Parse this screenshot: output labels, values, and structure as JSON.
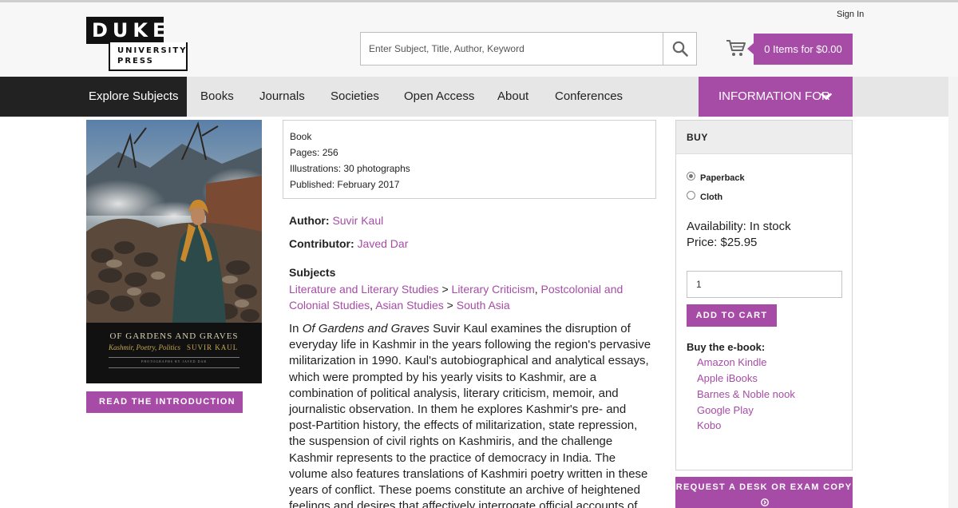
{
  "header": {
    "logo_word": "DUKE",
    "logo_sub_1": "UNIVERSITY",
    "logo_sub_2": "PRESS",
    "sign_in": "Sign In",
    "search_placeholder": "Enter Subject, Title, Author, Keyword",
    "cart_label": "0 Items for $0.00"
  },
  "nav": {
    "explore": "Explore Subjects",
    "items": [
      "Books",
      "Journals",
      "Societies",
      "Open Access",
      "About",
      "Conferences"
    ],
    "info_for": "INFORMATION FOR"
  },
  "book": {
    "cover": {
      "title": "OF GARDENS AND GRAVES",
      "subtitle": "Kashmir, Poetry, Politics",
      "author": "SUVIR KAUL",
      "credit": "PHOTOGRAPHS BY JAVED DAR"
    },
    "read_intro": "READ THE INTRODUCTION",
    "details": [
      "Book",
      "Pages: 256",
      "Illustrations: 30 photographs",
      "Published: February 2017"
    ],
    "author_label": "Author:",
    "author": "Suvir Kaul",
    "contributor_label": "Contributor:",
    "contributor": "Javed Dar",
    "subjects_label": "Subjects",
    "subjects": {
      "s1": "Literature and Literary Studies",
      "sep1": " > ",
      "s2": "Literary Criticism",
      "sep2": ", ",
      "s3": "Postcolonial and Colonial Studies",
      "sep3": ", ",
      "s4": "Asian Studies",
      "sep4": " > ",
      "s5": "South Asia"
    },
    "description": {
      "prefix": "In ",
      "title_italic": "Of Gardens and Graves",
      "body": " Suvir Kaul examines the disruption of everyday life in Kashmir in the years following the region's pervasive militarization in 1990. Kaul's autobiographical and analytical essays, which were prompted by his yearly visits to Kashmir, are a combination of political analysis, literary criticism, memoir, and journalistic observation. In them he explores Kashmir's pre- and post-Partition history, the effects of militarization, state repression, the suspension of civil rights on Kashmiris, and the challenge Kashmir represents to the practice of democracy in India. The volume also features translations of Kashmiri poetry written in these years of conflict. These poems constitute an archive of heightened feelings and desires that affectively interrogate official accounts of Kashmir while telling us much about"
    }
  },
  "buy": {
    "heading": "BUY",
    "formats": [
      {
        "label": "Paperback",
        "selected": true
      },
      {
        "label": "Cloth",
        "selected": false
      }
    ],
    "availability": "Availability: In stock",
    "price": "Price: $25.95",
    "quantity": "1",
    "add_to_cart": "ADD TO CART",
    "ebook_label": "Buy the e-book:",
    "ebook_links": [
      "Amazon Kindle",
      "Apple iBooks",
      "Barnes & Noble nook",
      "Google Play",
      "Kobo"
    ],
    "desk_copy": "REQUEST A DESK OR EXAM COPY"
  },
  "colors": {
    "accent": "#a64ca6",
    "nav_dark": "#222222",
    "nav_bg": "#e6e6e6"
  }
}
